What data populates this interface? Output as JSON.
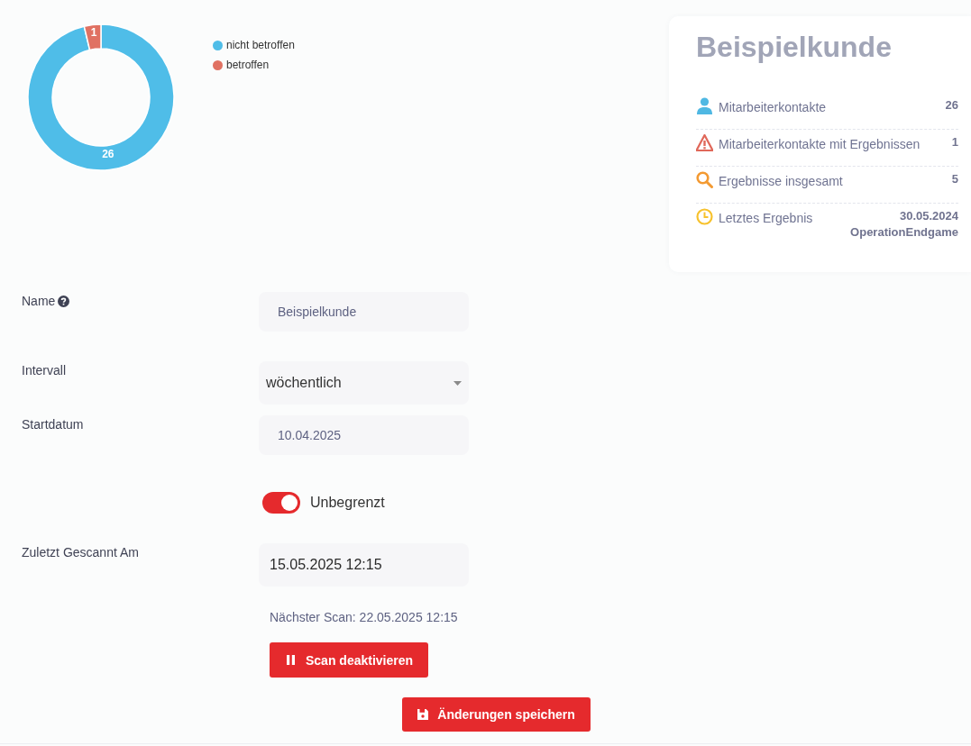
{
  "chart": {
    "chart_data": {
      "type": "donut",
      "categories": [
        "nicht betroffen",
        "betroffen"
      ],
      "values": [
        26,
        1
      ],
      "colors": [
        "#4fbde8",
        "#e07162"
      ],
      "data_labels": true
    }
  },
  "summary_card": {
    "title": "Beispielkunde",
    "stats": [
      {
        "kind": "person",
        "label": "Mitarbeiterkontakte",
        "value": "26"
      },
      {
        "kind": "warning",
        "label": "Mitarbeiterkontakte mit Ergebnissen",
        "value": "1"
      },
      {
        "kind": "search",
        "label": "Ergebnisse insgesamt",
        "value": "5"
      },
      {
        "kind": "clock",
        "label": "Letztes Ergebnis",
        "value": "30.05.2024",
        "subvalue": "OperationEndgame"
      }
    ]
  },
  "form": {
    "fields": [
      {
        "kind": "input",
        "label": "Name",
        "help": true,
        "value": "Beispielkunde"
      },
      {
        "kind": "select",
        "label": "Intervall",
        "help": false,
        "value": "wöchentlich"
      },
      {
        "kind": "date",
        "label": "Startdatum",
        "help": false,
        "value": "10.04.2025"
      },
      {
        "kind": "toggle",
        "on": true,
        "text": "Unbegrenzt"
      },
      {
        "kind": "readonly",
        "label": "Zuletzt Gescannt Am",
        "help": false,
        "value": "15.05.2025 12:15"
      }
    ]
  },
  "scan": {
    "next_scan": "Nächster Scan: 22.05.2025 12:15",
    "button": "Scan deaktivieren"
  },
  "save_button": "Änderungen speichern"
}
